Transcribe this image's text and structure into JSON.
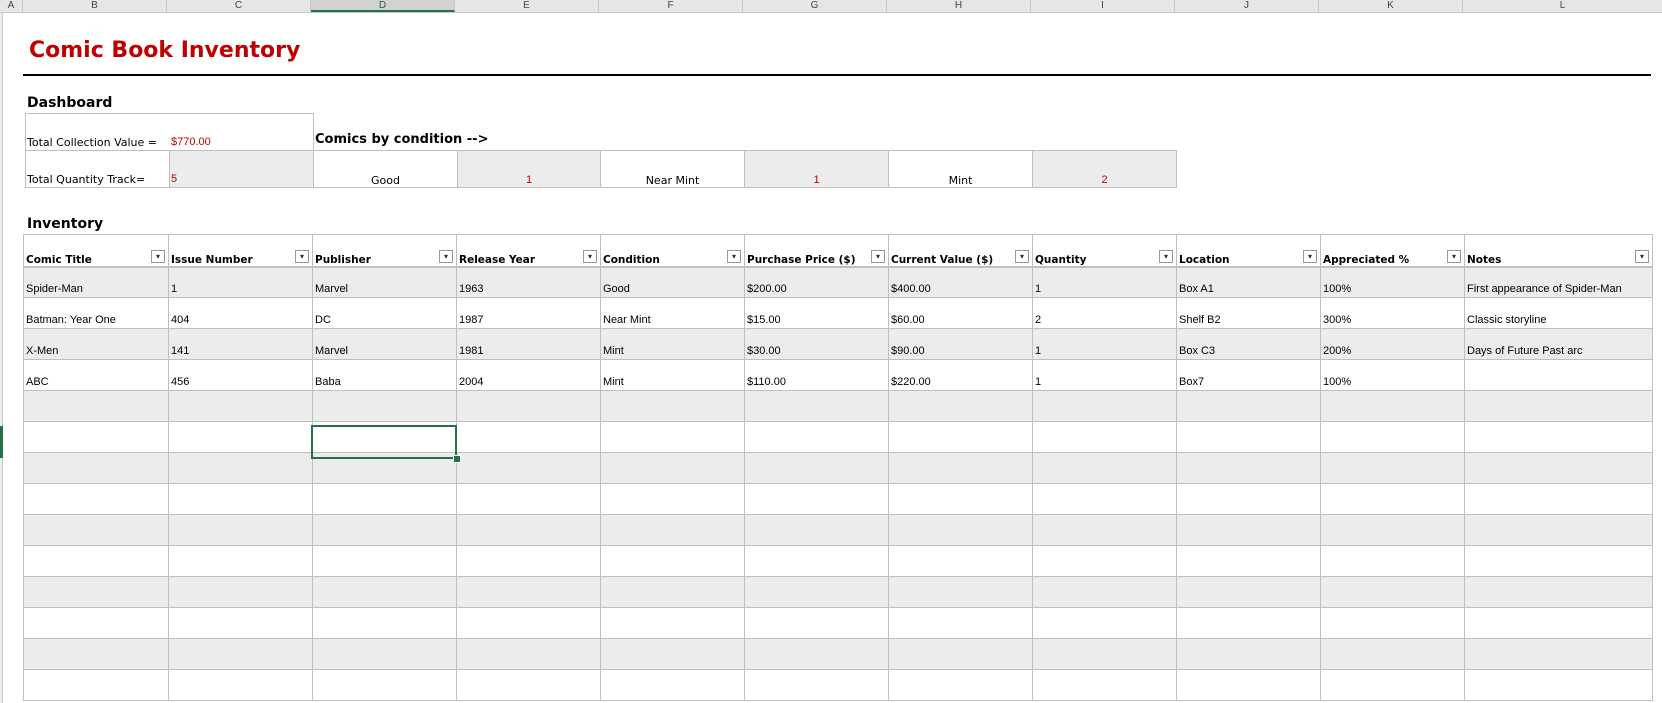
{
  "columns": [
    "A",
    "B",
    "C",
    "D",
    "E",
    "F",
    "G",
    "H",
    "I",
    "J",
    "K",
    "L"
  ],
  "selected_column": "D",
  "title": "Comic Book Inventory",
  "dashboard": {
    "heading": "Dashboard",
    "total_value_label": "Total Collection Value =",
    "total_value": "$770.00",
    "total_qty_label": "Total Quantity Track=",
    "total_qty": "5",
    "condition_heading": "Comics by condition -->",
    "conditions": [
      {
        "label": "Good",
        "count": "1"
      },
      {
        "label": "Near Mint",
        "count": "1"
      },
      {
        "label": "Mint",
        "count": "2"
      }
    ]
  },
  "inventory": {
    "heading": "Inventory",
    "headers": [
      "Comic Title",
      "Issue Number",
      "Publisher",
      "Release Year",
      "Condition",
      "Purchase Price ($)",
      "Current Value ($)",
      "Quantity",
      "Location",
      "Appreciated %",
      "Notes"
    ],
    "rows": [
      [
        "Spider-Man",
        "1",
        "Marvel",
        "1963",
        "Good",
        "$200.00",
        "$400.00",
        "1",
        "Box A1",
        "100%",
        "First appearance of Spider-Man"
      ],
      [
        "Batman: Year One",
        "404",
        "DC",
        "1987",
        "Near Mint",
        "$15.00",
        "$60.00",
        "2",
        "Shelf B2",
        "300%",
        "Classic storyline"
      ],
      [
        "X-Men",
        "141",
        "Marvel",
        "1981",
        "Mint",
        "$30.00",
        "$90.00",
        "1",
        "Box C3",
        "200%",
        "Days of Future Past arc"
      ],
      [
        "ABC",
        "456",
        "Baba",
        "2004",
        "Mint",
        "$110.00",
        "$220.00",
        "1",
        "Box7",
        "100%",
        ""
      ]
    ],
    "empty_rows": 10
  },
  "icons": {
    "filter_dropdown": "chevron-down-icon"
  },
  "colors": {
    "accent_red": "#c00000",
    "excel_green": "#217346",
    "band": "#ececec"
  }
}
